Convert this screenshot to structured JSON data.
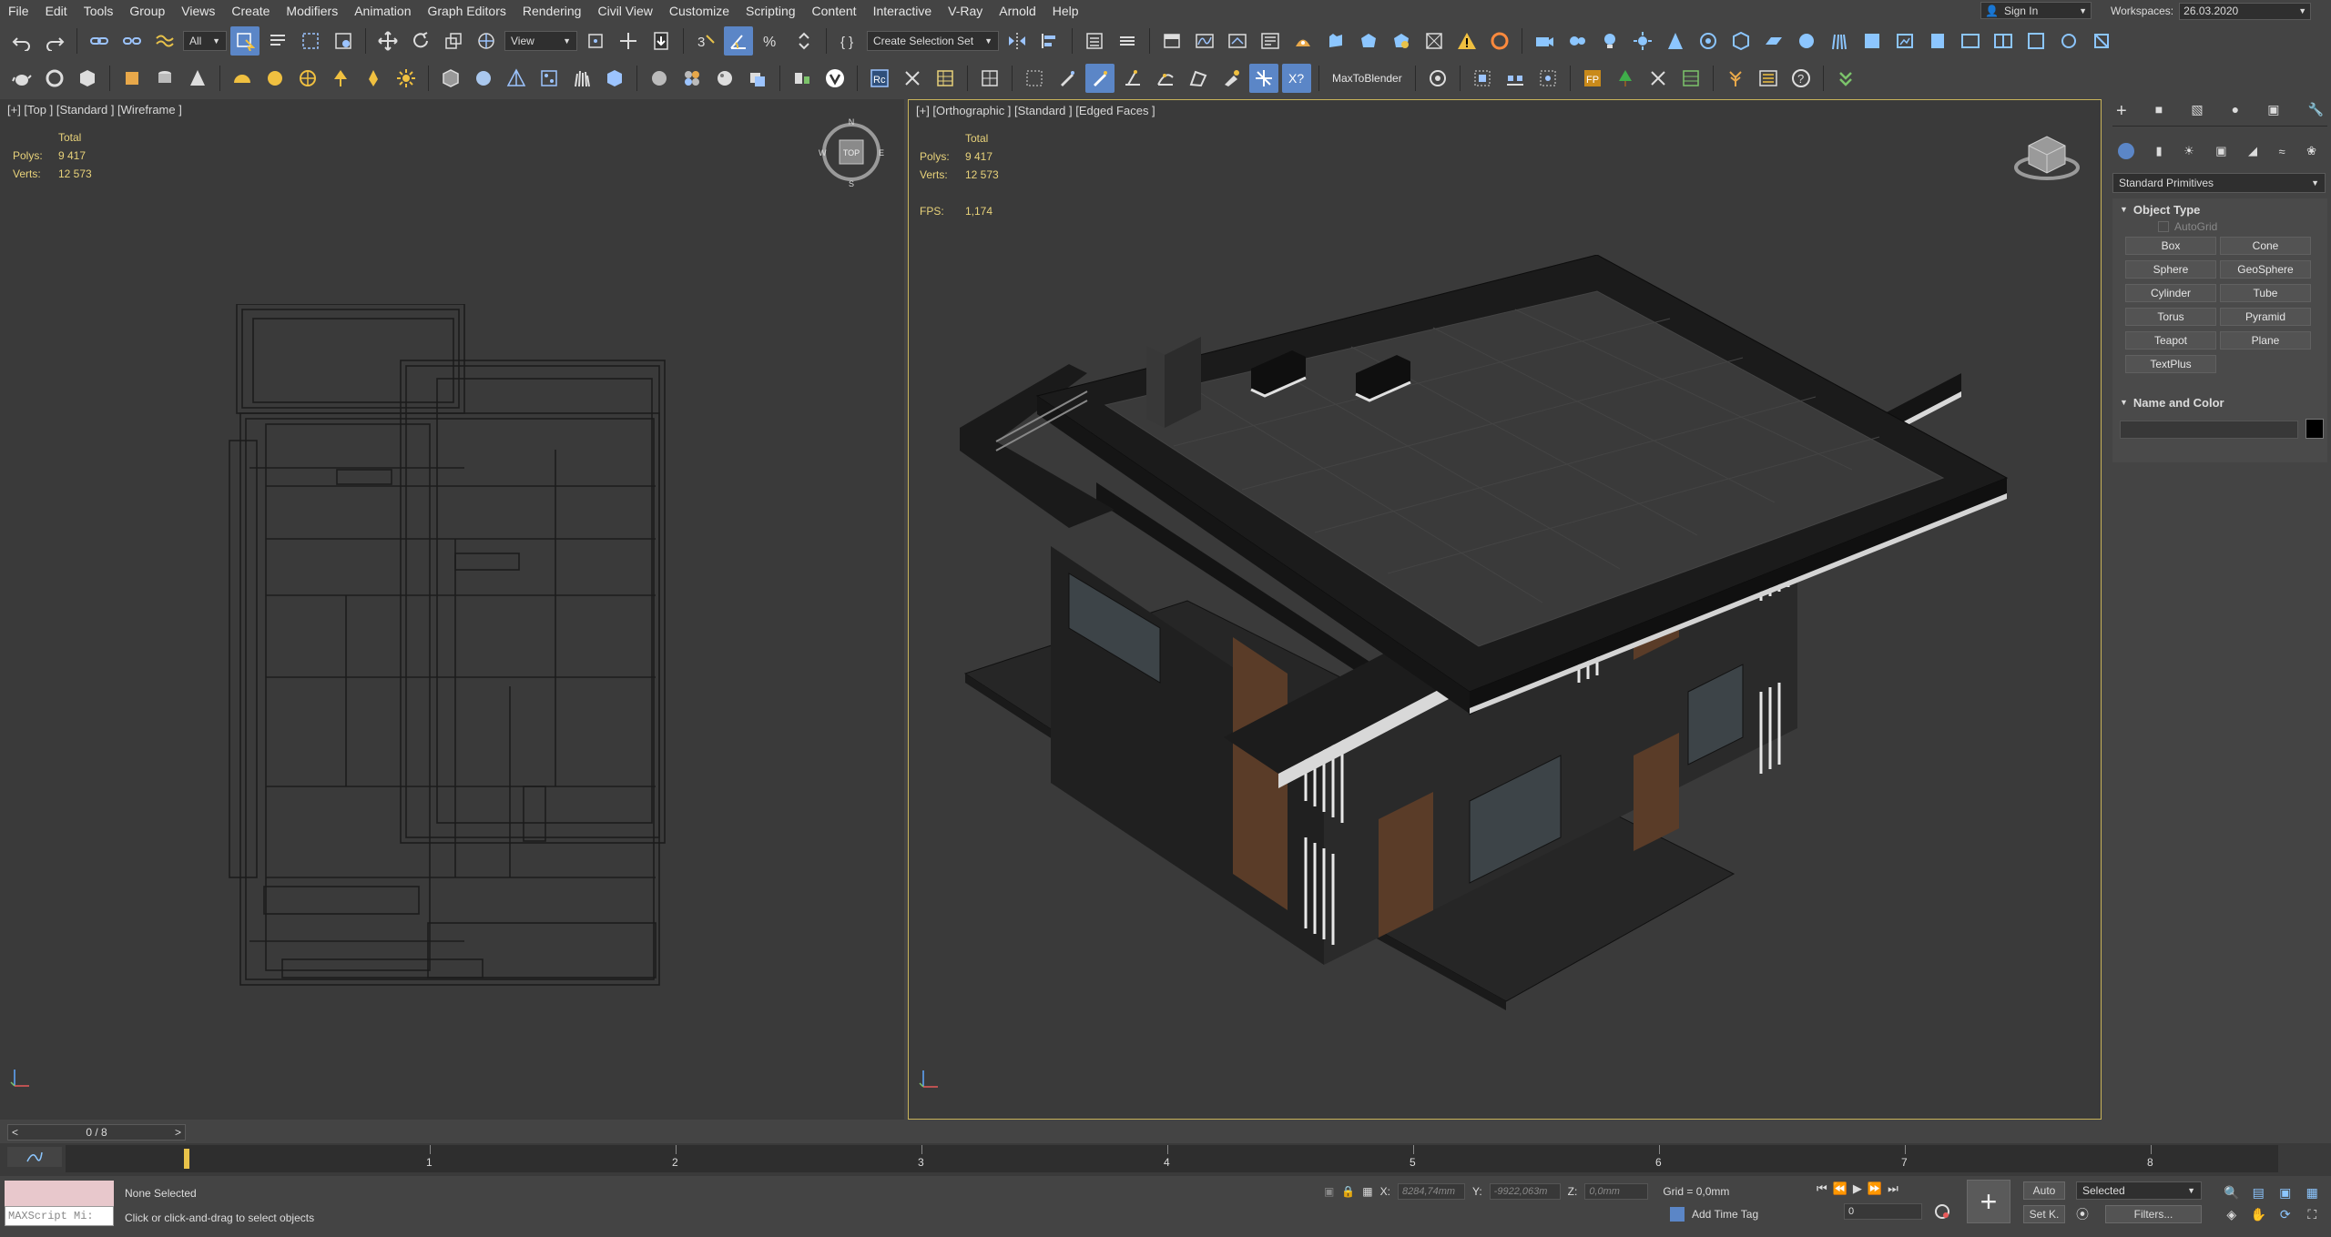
{
  "menu": [
    "File",
    "Edit",
    "Tools",
    "Group",
    "Views",
    "Create",
    "Modifiers",
    "Animation",
    "Graph Editors",
    "Rendering",
    "Civil View",
    "Customize",
    "Scripting",
    "Content",
    "Interactive",
    "V-Ray",
    "Arnold",
    "Help"
  ],
  "signin": {
    "label": "Sign In"
  },
  "workspaces": {
    "label": "Workspaces:",
    "value": "26.03.2020"
  },
  "toolbar1": {
    "filter_value": "All",
    "ref_coord_value": "View",
    "selection_set_placeholder": "Create Selection Set"
  },
  "toolbar2": {
    "plugin_label": "MaxToBlender"
  },
  "viewport_top": {
    "label": "[+] [Top ] [Standard ] [Wireframe ]",
    "total_label": "Total",
    "polys_label": "Polys:",
    "polys_value": "9 417",
    "verts_label": "Verts:",
    "verts_value": "12 573",
    "viewcube_text": "TOP",
    "compass": {
      "n": "N",
      "s": "S",
      "e": "E",
      "w": "W"
    }
  },
  "viewport_ortho": {
    "label": "[+] [Orthographic ] [Standard ] [Edged Faces ]",
    "total_label": "Total",
    "polys_label": "Polys:",
    "polys_value": "9 417",
    "verts_label": "Verts:",
    "verts_value": "12 573",
    "fps_label": "FPS:",
    "fps_value": "1,174"
  },
  "command_panel": {
    "category_value": "Standard Primitives",
    "object_type_title": "Object Type",
    "autogrid_label": "AutoGrid",
    "buttons": [
      "Box",
      "Cone",
      "Sphere",
      "GeoSphere",
      "Cylinder",
      "Tube",
      "Torus",
      "Pyramid",
      "Teapot",
      "Plane",
      "TextPlus"
    ],
    "name_color_title": "Name and Color",
    "swatch_color": "#000000"
  },
  "timeline": {
    "frame_label": "0 / 8",
    "ticks": [
      "1",
      "2",
      "3",
      "4",
      "5",
      "6",
      "7",
      "8"
    ]
  },
  "status": {
    "maxscript_placeholder": "MAXScript Mi:",
    "selection_text": "None Selected",
    "prompt_text": "Click or click-and-drag to select objects",
    "x_label": "X:",
    "x_value": "8284,74mm",
    "y_label": "Y:",
    "y_value": "-9922,063m",
    "z_label": "Z:",
    "z_value": "0,0mm",
    "grid_text": "Grid = 0,0mm",
    "add_time_tag": "Add Time Tag",
    "auto_label": "Auto",
    "setkey_label": "Set K.",
    "selected_value": "Selected",
    "frame_value": "0",
    "filters_label": "Filters..."
  },
  "colors": {
    "accent": "#5b86c7",
    "viewport_bg": "#3a3a3a",
    "active_border": "#c8b35a",
    "stats_color": "#e8d27a",
    "key_color": "#e8c24a"
  }
}
